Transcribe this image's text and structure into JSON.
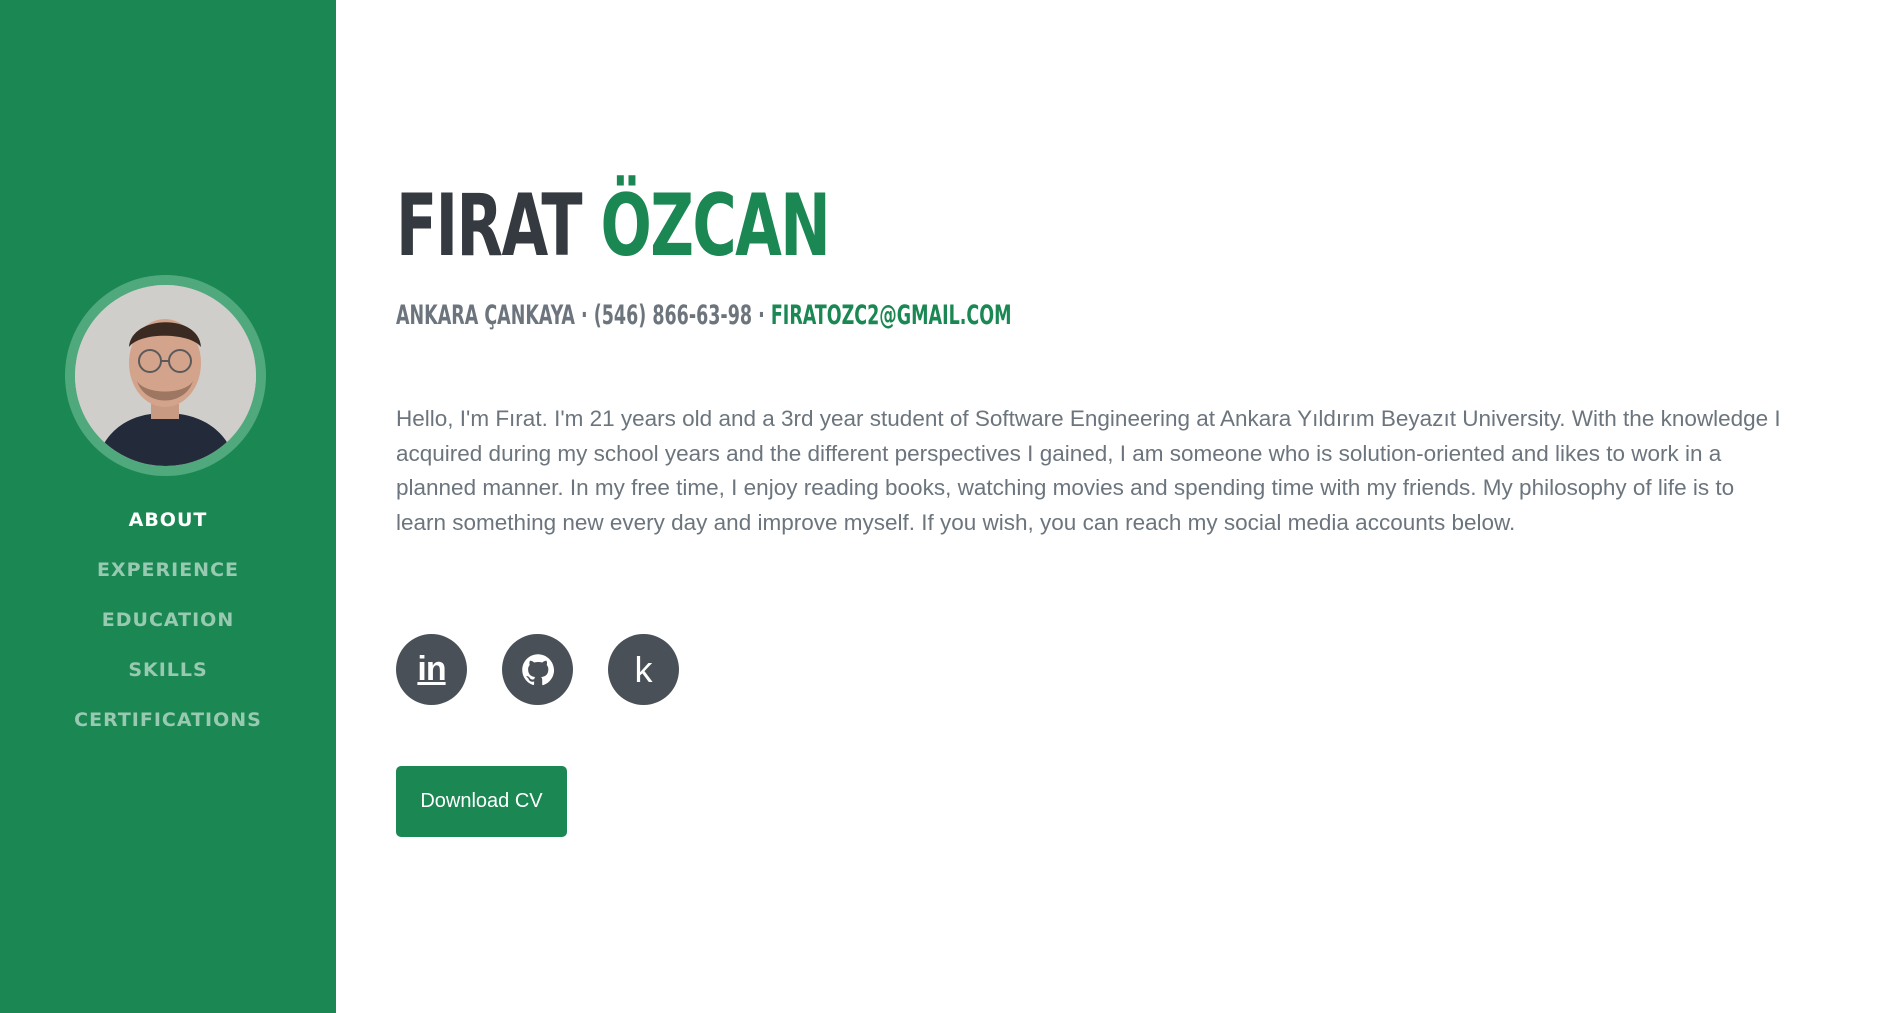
{
  "profile": {
    "first_name": "FIRAT",
    "last_name": "ÖZCAN",
    "location": "ANKARA ÇANKAYA",
    "phone": "(546) 866-63-98",
    "email": "FIRATOZC2@GMAIL.COM",
    "separator": "·"
  },
  "nav": {
    "items": [
      {
        "label": "ABOUT",
        "active": true
      },
      {
        "label": "EXPERIENCE",
        "active": false
      },
      {
        "label": "EDUCATION",
        "active": false
      },
      {
        "label": "SKILLS",
        "active": false
      },
      {
        "label": "CERTIFICATIONS",
        "active": false
      }
    ]
  },
  "about": {
    "bio": "Hello, I'm Fırat. I'm 21 years old and a 3rd year student of Software Engineering at Ankara Yıldırım Beyazıt University. With the knowledge I acquired during my school years and the different perspectives I gained, I am someone who is solution-oriented and likes to work in a planned manner. In my free time, I enjoy reading books, watching movies and spending time with my friends. My philosophy of life is to learn something new every day and improve myself. If you wish, you can reach my social media accounts below."
  },
  "socials": [
    {
      "icon": "linkedin-icon",
      "glyph": "in"
    },
    {
      "icon": "github-icon",
      "glyph": ""
    },
    {
      "icon": "kaggle-icon",
      "glyph": "k"
    }
  ],
  "download_button": {
    "label": "Download CV"
  },
  "colors": {
    "brand": "#1b8753",
    "dark": "#343a40",
    "muted": "#6c757d",
    "icon_bg": "#495057"
  }
}
